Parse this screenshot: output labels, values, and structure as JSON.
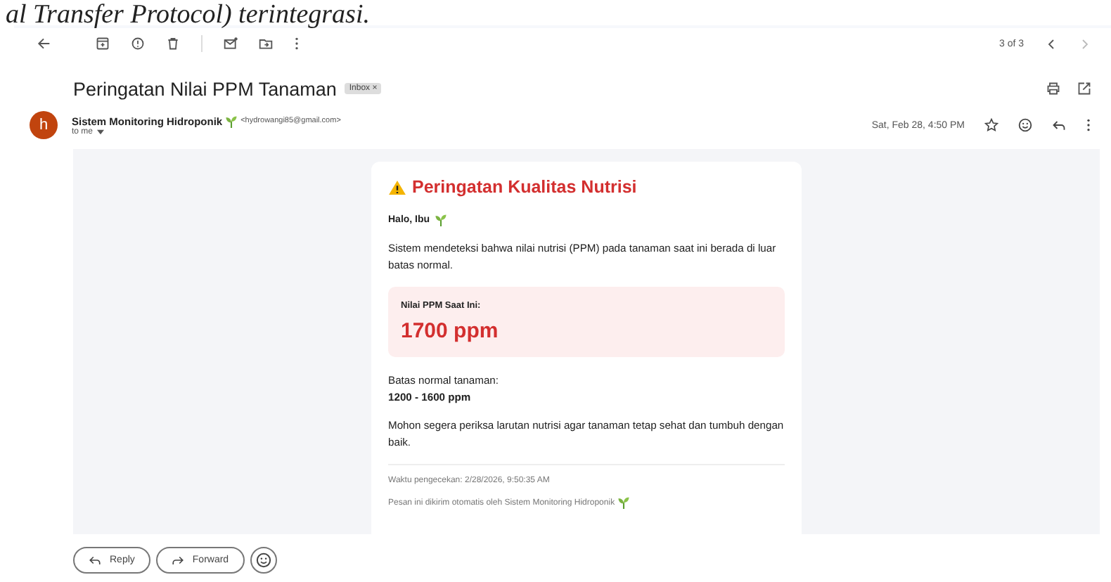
{
  "document_text": "al Transfer Protocol) terintegrasi.",
  "pager": "3 of 3",
  "subject": "Peringatan Nilai PPM Tanaman",
  "label": {
    "text": "Inbox",
    "close": "×"
  },
  "sender": {
    "avatar": "h",
    "name": "Sistem Monitoring Hidroponik",
    "email": "<hydrowangi85@gmail.com>",
    "recipient": "to me",
    "date": "Sat, Feb 28, 4:50 PM"
  },
  "email_body": {
    "title": "Peringatan Kualitas Nutrisi",
    "greeting": "Halo, Ibu",
    "intro": "Sistem mendeteksi bahwa nilai nutrisi (PPM) pada tanaman saat ini berada di luar batas normal.",
    "reading_label": "Nilai PPM Saat Ini:",
    "reading_value": "1700 ppm",
    "range_label": "Batas normal tanaman:",
    "range_value": "1200 - 1600 ppm",
    "request": "Mohon segera periksa larutan nutrisi agar tanaman tetap sehat dan tumbuh dengan baik.",
    "check_time": "Waktu pengecekan: 2/28/2026, 9:50:35 AM",
    "footer": "Pesan ini dikirim otomatis oleh Sistem Monitoring Hidroponik"
  },
  "reply_buttons": [
    "Reply",
    "Forward"
  ]
}
